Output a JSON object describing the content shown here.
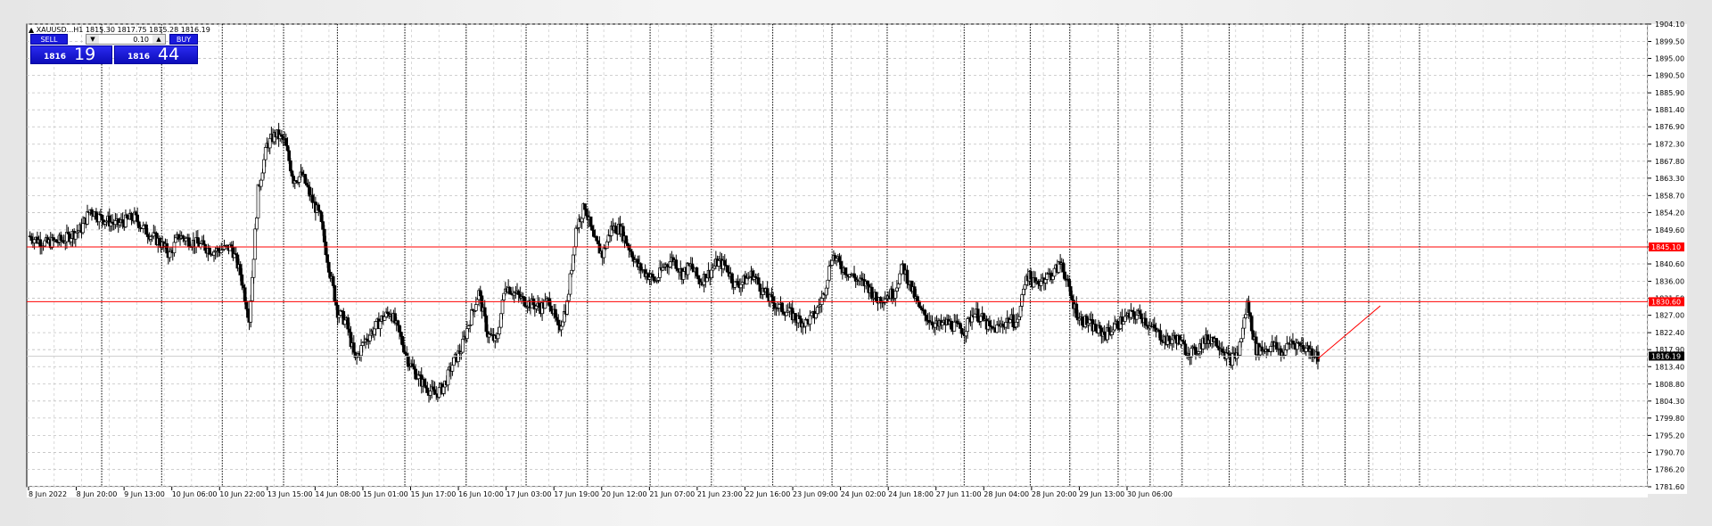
{
  "window": {
    "title": "XAUUSD...H1 1815.30 1817.75 1815.28 1816.19"
  },
  "trade_panel": {
    "sell_label": "SELL",
    "buy_label": "BUY",
    "lot": "0.10",
    "sell_small": "1816",
    "sell_big": "19",
    "buy_small": "1816",
    "buy_big": "44",
    "down_arrow": "▼",
    "up_arrow": "▲"
  },
  "colors": {
    "candle": "#000000",
    "grid": "#c0c0c0",
    "level": "#ff0000",
    "sell_bg": "#1a1adb",
    "buy_bg": "#1a1adb",
    "price_tag": "#000000"
  },
  "chart_data": {
    "type": "candlestick",
    "symbol": "XAUUSD",
    "timeframe": "H1",
    "ylim": [
      1781.6,
      1904.1
    ],
    "y_ticks": [
      "1904.10",
      "1899.50",
      "1895.00",
      "1890.50",
      "1885.90",
      "1881.40",
      "1876.90",
      "1872.30",
      "1867.80",
      "1863.30",
      "1858.70",
      "1854.20",
      "1849.60",
      "1845.10",
      "1840.60",
      "1836.00",
      "1831.50",
      "1827.00",
      "1822.40",
      "1817.90",
      "1813.40",
      "1808.80",
      "1804.30",
      "1799.80",
      "1795.20",
      "1790.70",
      "1786.20",
      "1781.60"
    ],
    "x_ticks": [
      "8 Jun 2022",
      "8 Jun 20:00",
      "9 Jun 13:00",
      "10 Jun 06:00",
      "10 Jun 22:00",
      "13 Jun 15:00",
      "14 Jun 08:00",
      "15 Jun 01:00",
      "15 Jun 17:00",
      "16 Jun 10:00",
      "17 Jun 03:00",
      "17 Jun 19:00",
      "20 Jun 12:00",
      "21 Jun 07:00",
      "21 Jun 23:00",
      "22 Jun 16:00",
      "23 Jun 09:00",
      "24 Jun 02:00",
      "24 Jun 18:00",
      "27 Jun 11:00",
      "28 Jun 04:00",
      "28 Jun 20:00",
      "29 Jun 13:00",
      "30 Jun 06:00"
    ],
    "price_trend": [
      [
        0,
        1848
      ],
      [
        2,
        1846
      ],
      [
        4,
        1847
      ],
      [
        6,
        1850
      ],
      [
        7,
        1855
      ],
      [
        8,
        1853
      ],
      [
        10,
        1851
      ],
      [
        12,
        1853
      ],
      [
        13,
        1850
      ],
      [
        15,
        1846
      ],
      [
        16,
        1843
      ],
      [
        17,
        1848
      ],
      [
        18,
        1847
      ],
      [
        19,
        1846
      ],
      [
        21,
        1844
      ],
      [
        23,
        1845
      ],
      [
        24,
        1838
      ],
      [
        25,
        1826
      ],
      [
        26,
        1860
      ],
      [
        27,
        1872
      ],
      [
        28,
        1875
      ],
      [
        29,
        1873
      ],
      [
        30,
        1863
      ],
      [
        31,
        1864
      ],
      [
        32,
        1858
      ],
      [
        33,
        1853
      ],
      [
        34,
        1840
      ],
      [
        35,
        1828
      ],
      [
        36,
        1825
      ],
      [
        37,
        1815
      ],
      [
        38,
        1820
      ],
      [
        39,
        1823
      ],
      [
        40,
        1826
      ],
      [
        41,
        1828
      ],
      [
        42,
        1822
      ],
      [
        43,
        1815
      ],
      [
        44,
        1811
      ],
      [
        45,
        1808
      ],
      [
        46,
        1806
      ],
      [
        47,
        1808
      ],
      [
        48,
        1814
      ],
      [
        49,
        1818
      ],
      [
        50,
        1826
      ],
      [
        51,
        1833
      ],
      [
        52,
        1822
      ],
      [
        53,
        1820
      ],
      [
        54,
        1835
      ],
      [
        55,
        1833
      ],
      [
        56,
        1831
      ],
      [
        57,
        1830
      ],
      [
        58,
        1829
      ],
      [
        59,
        1831
      ],
      [
        60,
        1823
      ],
      [
        61,
        1830
      ],
      [
        62,
        1850
      ],
      [
        63,
        1856
      ],
      [
        64,
        1847
      ],
      [
        65,
        1843
      ],
      [
        66,
        1850
      ],
      [
        67,
        1850
      ],
      [
        68,
        1845
      ],
      [
        69,
        1840
      ],
      [
        70,
        1838
      ],
      [
        71,
        1836
      ],
      [
        72,
        1840
      ],
      [
        73,
        1842
      ],
      [
        74,
        1838
      ],
      [
        75,
        1840
      ],
      [
        76,
        1836
      ],
      [
        77,
        1838
      ],
      [
        78,
        1841
      ],
      [
        79,
        1840
      ],
      [
        80,
        1835
      ],
      [
        81,
        1836
      ],
      [
        82,
        1838
      ],
      [
        83,
        1834
      ],
      [
        84,
        1831
      ],
      [
        85,
        1829
      ],
      [
        86,
        1828
      ],
      [
        87,
        1826
      ],
      [
        88,
        1825
      ],
      [
        89,
        1827
      ],
      [
        90,
        1832
      ],
      [
        91,
        1843
      ],
      [
        92,
        1840
      ],
      [
        93,
        1838
      ],
      [
        94,
        1836
      ],
      [
        95,
        1835
      ],
      [
        96,
        1831
      ],
      [
        97,
        1832
      ],
      [
        98,
        1833
      ],
      [
        99,
        1840
      ],
      [
        100,
        1834
      ],
      [
        101,
        1828
      ],
      [
        102,
        1826
      ],
      [
        103,
        1824
      ],
      [
        104,
        1825
      ],
      [
        105,
        1824
      ],
      [
        106,
        1823
      ],
      [
        107,
        1828
      ],
      [
        108,
        1826
      ],
      [
        109,
        1823
      ],
      [
        110,
        1824
      ],
      [
        111,
        1826
      ],
      [
        112,
        1825
      ],
      [
        113,
        1838
      ],
      [
        114,
        1835
      ],
      [
        115,
        1837
      ],
      [
        116,
        1838
      ],
      [
        117,
        1841
      ],
      [
        118,
        1832
      ],
      [
        119,
        1826
      ],
      [
        120,
        1825
      ],
      [
        121,
        1823
      ],
      [
        122,
        1822
      ],
      [
        123,
        1824
      ],
      [
        124,
        1826
      ],
      [
        125,
        1827
      ],
      [
        126,
        1827
      ],
      [
        127,
        1824
      ],
      [
        128,
        1822
      ],
      [
        129,
        1820
      ],
      [
        130,
        1821
      ],
      [
        131,
        1818
      ],
      [
        132,
        1817
      ],
      [
        133,
        1820
      ],
      [
        134,
        1821
      ],
      [
        135,
        1819
      ],
      [
        136,
        1815
      ],
      [
        137,
        1817
      ],
      [
        138,
        1830
      ],
      [
        139,
        1818
      ],
      [
        140,
        1818
      ],
      [
        141,
        1819
      ],
      [
        142,
        1817
      ],
      [
        143,
        1820
      ],
      [
        144,
        1819
      ],
      [
        145,
        1818
      ],
      [
        146,
        1816.2
      ]
    ],
    "levels": [
      1845.1,
      1830.6
    ],
    "current_price": 1816.19,
    "level_labels": [
      "1845.10",
      "1830.60"
    ],
    "current_label": "1816.19"
  }
}
